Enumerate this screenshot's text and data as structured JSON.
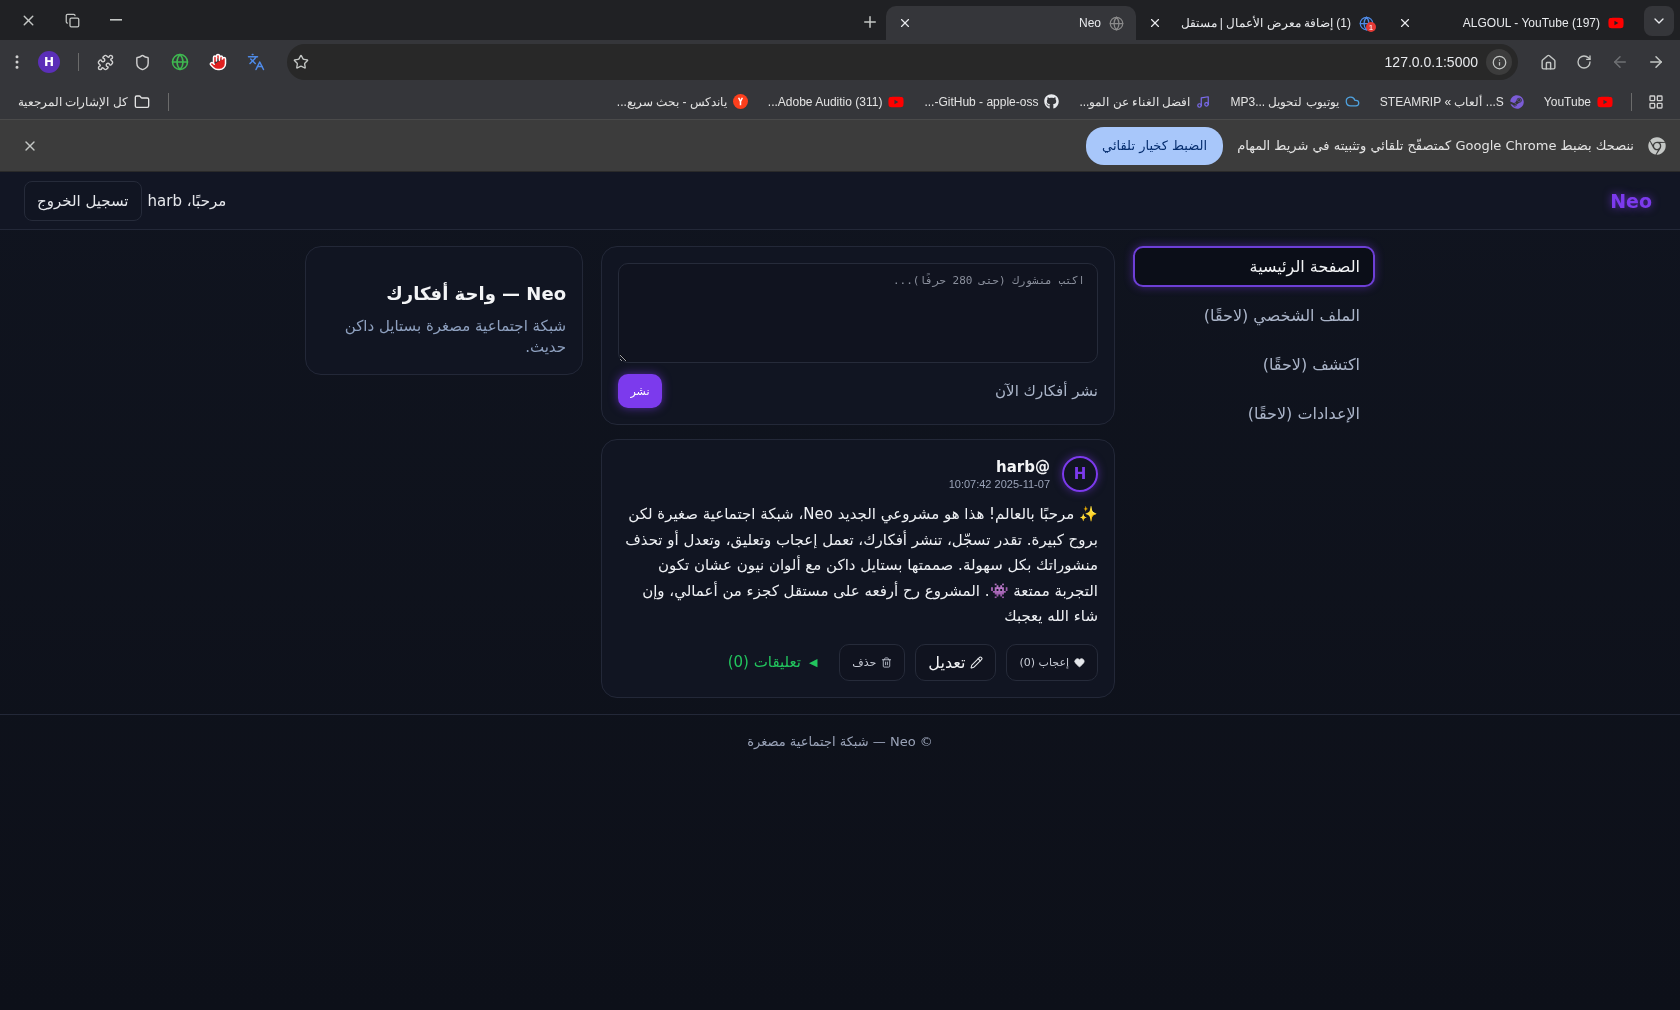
{
  "browser": {
    "tabs": [
      {
        "title": "(197) ALGOUL - YouTube",
        "selected": false
      },
      {
        "title": "(1) إضافة معرض الأعمال | مستقل",
        "badge": "1",
        "selected": false
      },
      {
        "title": "Neo",
        "selected": true
      }
    ],
    "address": "127.0.0.1:5000",
    "profile": "H",
    "bookmarks": [
      {
        "label": "YouTube"
      },
      {
        "label": "S... ألعاب » STEAMRIP"
      },
      {
        "label": "يوتيوب لتحويل ...MP3"
      },
      {
        "label": "افضل الغناء عن المو..."
      },
      {
        "label": "GitHub - apple-oss-..."
      },
      {
        "label": "(311) Adobe Auditio..."
      },
      {
        "label": "ياندكس - بحث سريع..."
      }
    ],
    "all_bookmarks": "كل الإشارات المرجعية",
    "infobar": {
      "message": "ننصحك بضبط Google Chrome كمتصفّح تلقائي وتثبيته في شريط المهام",
      "button": "الضبط كخيار تلقائي"
    }
  },
  "app": {
    "logo": "Neo",
    "greeting": "مرحبًا، harb",
    "logout": "تسجيل الخروج",
    "nav": [
      {
        "label": "الصفحة الرئيسية",
        "selected": true
      },
      {
        "label": "الملف الشخصي (لاحقًا)",
        "selected": false
      },
      {
        "label": "اكتشف (لاحقًا)",
        "selected": false
      },
      {
        "label": "الإعدادات (لاحقًا)",
        "selected": false
      }
    ],
    "composer": {
      "placeholder": "اكتب منشورك (حتى 280 حرفًا)...",
      "hint": "نشر أفكارك الآن",
      "button": "نشر"
    },
    "posts": [
      {
        "avatar": "H",
        "author": "@harb",
        "time": "2025-11-07 10:07:42",
        "text": "✨ مرحبًا بالعالم! هذا هو مشروعي الجديد Neo، شبكة اجتماعية صغيرة لكن بروح كبيرة. تقدر تسجّل، تنشر أفكارك، تعمل إعجاب وتعليق، وتعدل أو تحذف منشوراتك بكل سهولة. صممتها بستايل داكن مع ألوان نيون عشان تكون التجربة ممتعة 👾. المشروع رح أرفعه على مستقل كجزء من أعمالي، وإن شاء الله يعجبك",
        "like": "إعجاب (0)",
        "edit": "تعديل",
        "delete": "حذف",
        "toggle": "◀",
        "comments": "تعليقات (0)"
      }
    ],
    "about": {
      "title": "Neo — واحة أفكارك",
      "description": "شبكة اجتماعية مصغرة بستايل داكن حديث."
    },
    "footer": "© Neo — شبكة اجتماعية مصغرة"
  }
}
